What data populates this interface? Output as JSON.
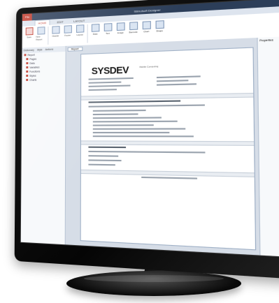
{
  "app": {
    "title": "Stimulsoft Designer",
    "file_tab": "File"
  },
  "ribbon_tabs": [
    "HOME",
    "EDIT",
    "LAYOUT"
  ],
  "ribbon_buttons": [
    "Save",
    "New Report",
    "Header",
    "Footer",
    "Layout",
    "Data",
    "Text",
    "Image",
    "Barcode",
    "Chart",
    "Shape"
  ],
  "left_panel": {
    "tabs": [
      "Dictionary",
      "Style",
      "Actions"
    ],
    "tree": [
      "Report",
      "Pages",
      "Data",
      "Variables",
      "Functions",
      "Styles",
      "Charts"
    ]
  },
  "document_tab": "Report",
  "report": {
    "logo": "SYSDEV",
    "logo_subtitle": "Mobile Computing"
  },
  "right_panel": {
    "title": "Properties"
  }
}
